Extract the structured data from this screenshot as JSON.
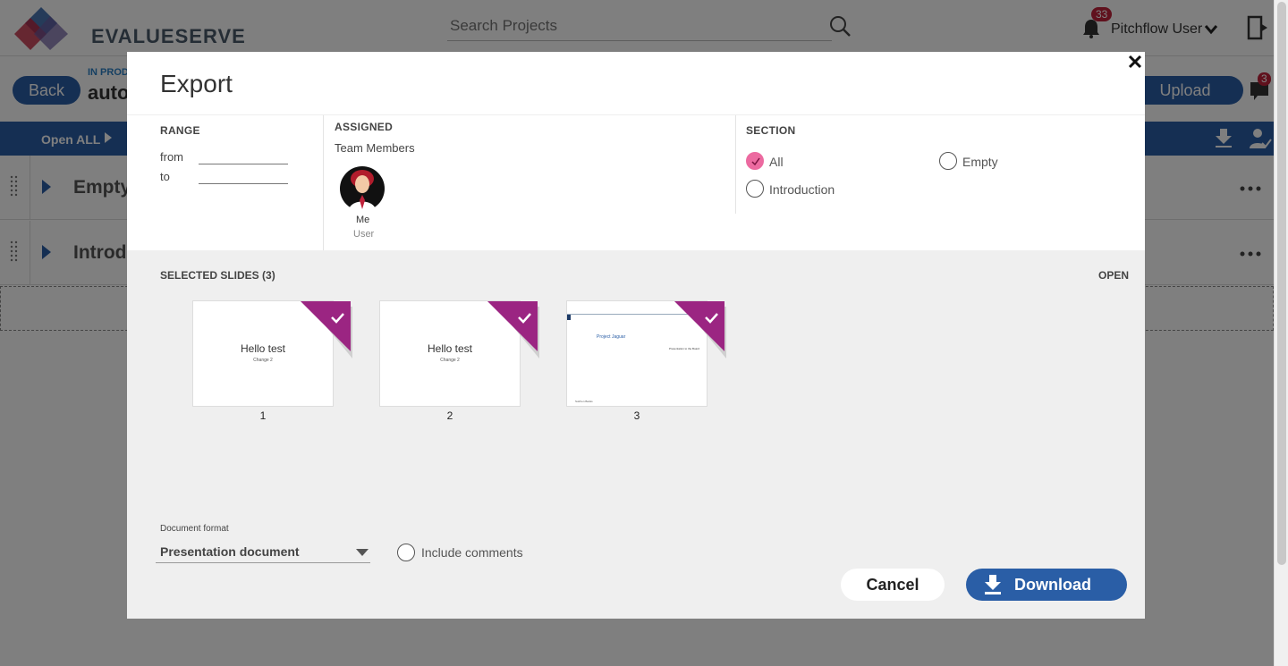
{
  "app": {
    "logo_text": "EVALUESERVE",
    "search": {
      "placeholder": "Search Projects"
    },
    "notifications": {
      "count": "33"
    },
    "user": {
      "name": "Pitchflow User"
    }
  },
  "project": {
    "back_label": "Back",
    "status": "IN PROD",
    "title": "auto",
    "upload_label": "Upload",
    "notes_count": "3"
  },
  "toolbar": {
    "open_all_label": "Open ALL"
  },
  "sections": [
    {
      "title": "Empty"
    },
    {
      "title": "Introd"
    }
  ],
  "modal": {
    "title": "Export",
    "range": {
      "heading": "RANGE",
      "from_label": "from",
      "to_label": "to"
    },
    "assigned": {
      "heading": "ASSIGNED",
      "team_label": "Team Members",
      "members": [
        {
          "name": "Me",
          "role": "User"
        }
      ]
    },
    "section": {
      "heading": "SECTION",
      "options": [
        {
          "label": "All",
          "checked": true
        },
        {
          "label": "Empty",
          "checked": false
        },
        {
          "label": "Introduction",
          "checked": false
        }
      ]
    },
    "selected_label": "SELECTED SLIDES (3)",
    "open_label": "OPEN",
    "slides": [
      {
        "number": "1",
        "title": "Hello test",
        "subtitle": "Change 2",
        "selected": true
      },
      {
        "number": "2",
        "title": "Hello test",
        "subtitle": "Change 2",
        "selected": true
      },
      {
        "number": "3",
        "title": "Project Jaguar",
        "subtitle": "Presentation to the Board",
        "footer": "Sutrhen Banks",
        "selected": true
      }
    ],
    "format": {
      "label": "Document format",
      "value": "Presentation document"
    },
    "include_comments_label": "Include comments",
    "cancel_label": "Cancel",
    "download_label": "Download"
  },
  "colors": {
    "brand_blue": "#2a5ea6",
    "accent_pink": "#ec6aa0",
    "slide_check_purple": "#9b2582",
    "badge_red": "#c0223b"
  }
}
